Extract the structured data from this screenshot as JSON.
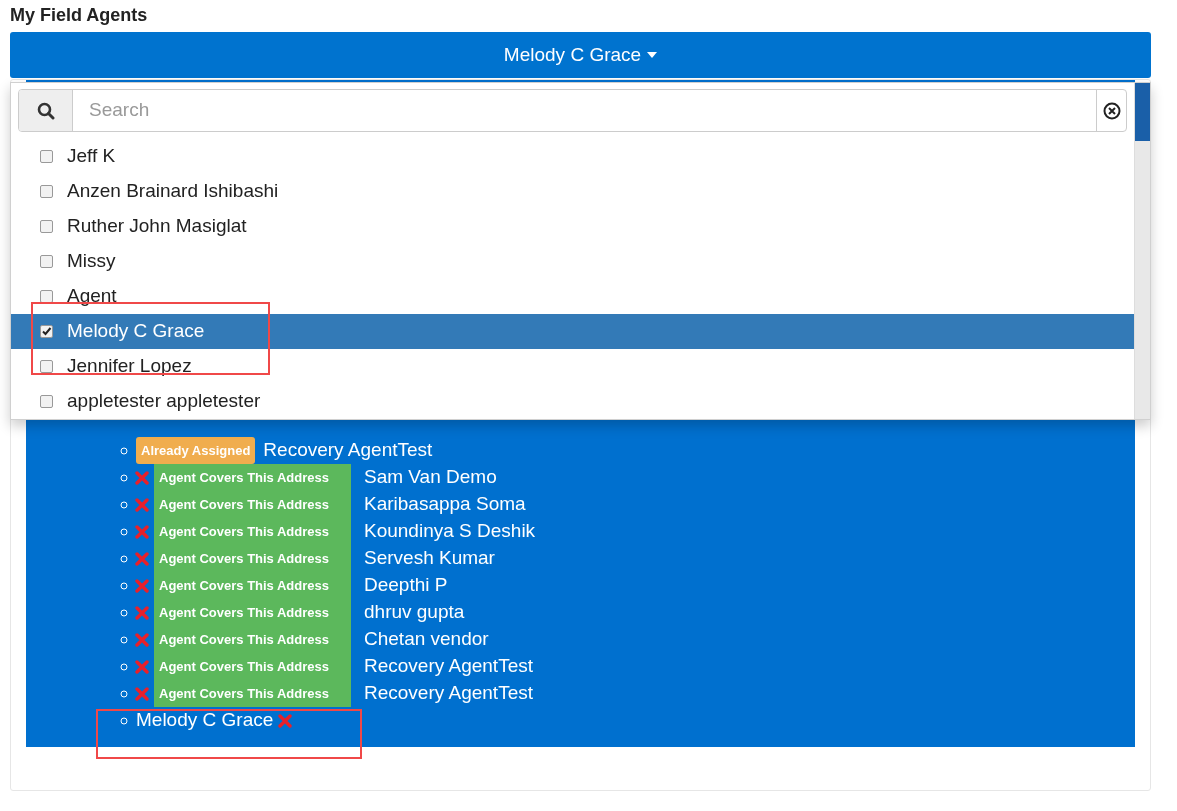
{
  "section_title": "My Field Agents",
  "agent_selector": {
    "label": "Melody C Grace"
  },
  "dropdown": {
    "search": {
      "placeholder": "Search"
    },
    "options": [
      {
        "name": "Jeff K",
        "checked": false,
        "selected": false
      },
      {
        "name": "Anzen Brainard Ishibashi",
        "checked": false,
        "selected": false
      },
      {
        "name": "Ruther John Masiglat",
        "checked": false,
        "selected": false
      },
      {
        "name": "Missy",
        "checked": false,
        "selected": false
      },
      {
        "name": "Agent",
        "checked": false,
        "selected": false
      },
      {
        "name": "Melody C Grace",
        "checked": true,
        "selected": true
      },
      {
        "name": "Jennifer Lopez",
        "checked": false,
        "selected": false
      },
      {
        "name": "appletester appletester",
        "checked": false,
        "selected": false
      }
    ]
  },
  "assignments": [
    {
      "kind": "assigned",
      "badge": "Already Assigned",
      "name": "Recovery AgentTest"
    },
    {
      "kind": "covers",
      "badge": "Agent Covers This Address",
      "name": "Sam Van Demo"
    },
    {
      "kind": "covers",
      "badge": "Agent Covers This Address",
      "name": "Karibasappa Soma"
    },
    {
      "kind": "covers",
      "badge": "Agent Covers This Address",
      "name": "Koundinya S Deshik"
    },
    {
      "kind": "covers",
      "badge": "Agent Covers This Address",
      "name": "Servesh Kumar"
    },
    {
      "kind": "covers",
      "badge": "Agent Covers This Address",
      "name": "Deepthi P"
    },
    {
      "kind": "covers",
      "badge": "Agent Covers This Address",
      "name": "dhruv gupta"
    },
    {
      "kind": "covers",
      "badge": "Agent Covers This Address",
      "name": "Chetan vendor"
    },
    {
      "kind": "covers",
      "badge": "Agent Covers This Address",
      "name": "Recovery AgentTest"
    },
    {
      "kind": "covers",
      "badge": "Agent Covers This Address",
      "name": "Recovery AgentTest"
    },
    {
      "kind": "new",
      "name": "Melody C Grace"
    }
  ]
}
